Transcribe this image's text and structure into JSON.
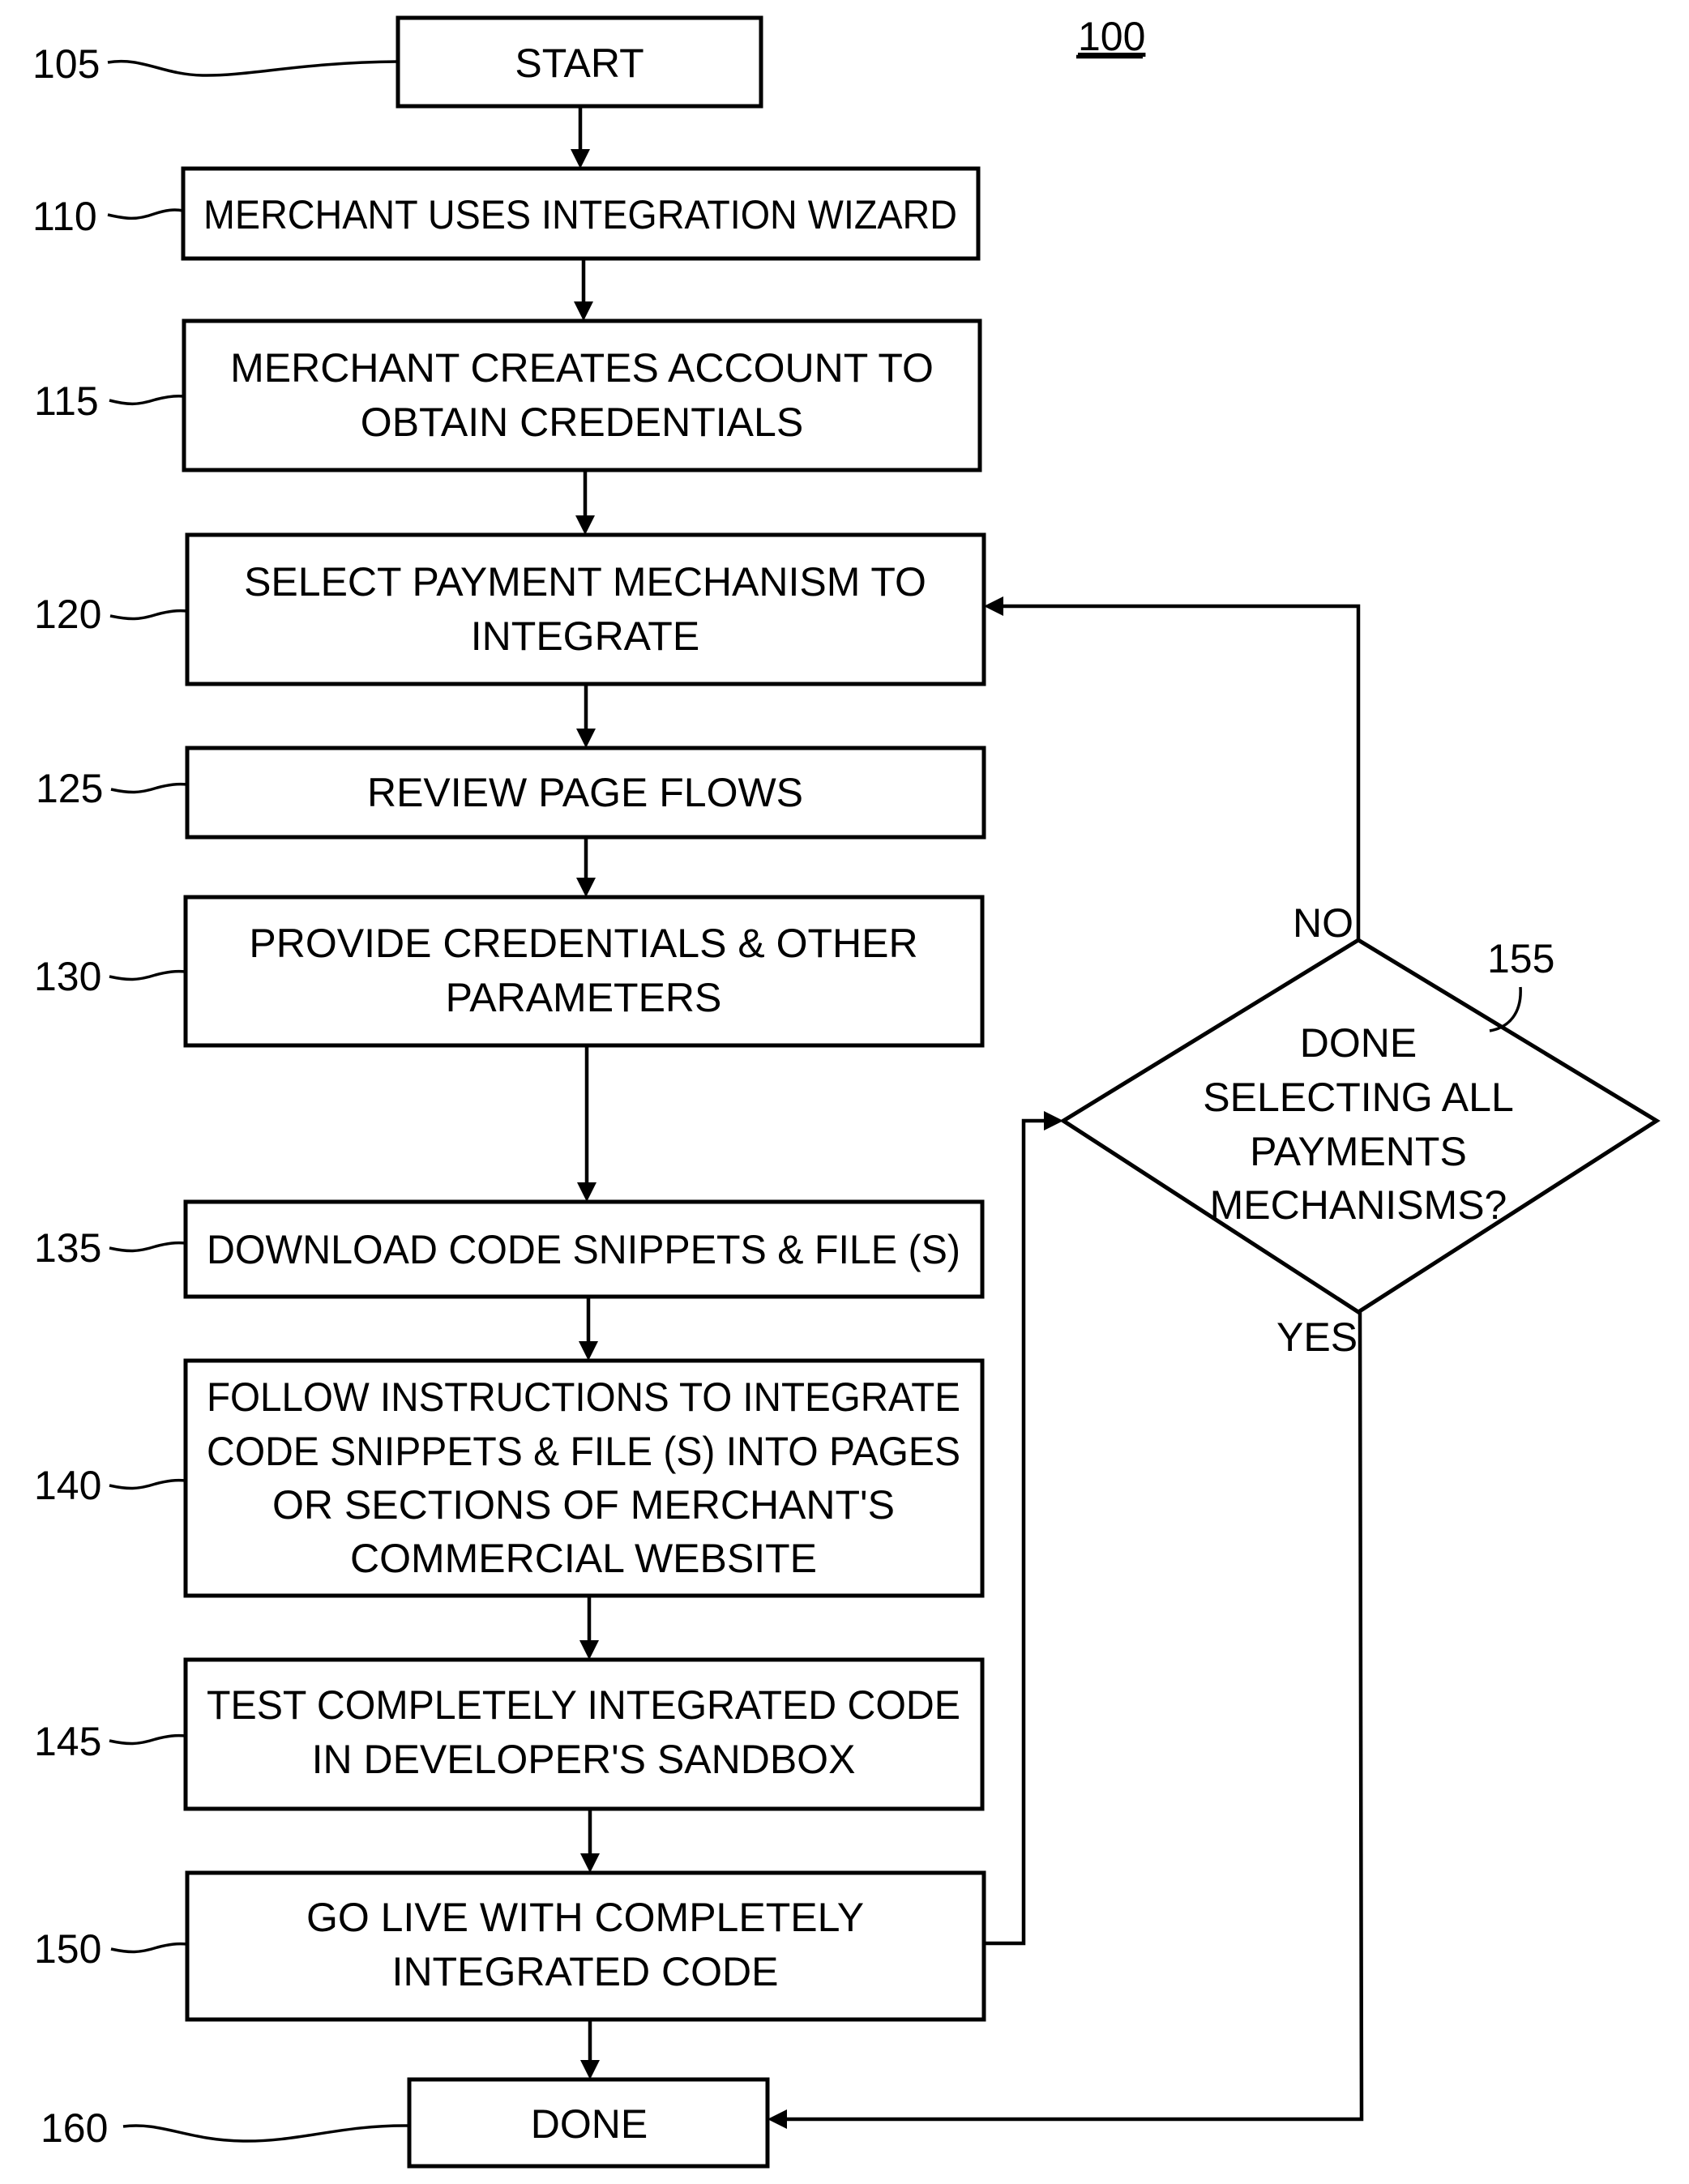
{
  "figure": {
    "number": "100"
  },
  "steps": [
    {
      "ref": "105",
      "lines": [
        "START"
      ]
    },
    {
      "ref": "110",
      "lines": [
        "MERCHANT USES INTEGRATION WIZARD"
      ]
    },
    {
      "ref": "115",
      "lines": [
        "MERCHANT CREATES ACCOUNT TO",
        "OBTAIN CREDENTIALS"
      ]
    },
    {
      "ref": "120",
      "lines": [
        "SELECT PAYMENT MECHANISM TO",
        "INTEGRATE"
      ]
    },
    {
      "ref": "125",
      "lines": [
        "REVIEW PAGE FLOWS"
      ]
    },
    {
      "ref": "130",
      "lines": [
        "PROVIDE CREDENTIALS & OTHER",
        "PARAMETERS"
      ]
    },
    {
      "ref": "135",
      "lines": [
        "DOWNLOAD CODE SNIPPETS & FILE (S)"
      ]
    },
    {
      "ref": "140",
      "lines": [
        "FOLLOW INSTRUCTIONS TO INTEGRATE",
        "CODE SNIPPETS & FILE (S) INTO PAGES",
        "OR SECTIONS OF MERCHANT'S",
        "COMMERCIAL WEBSITE"
      ]
    },
    {
      "ref": "145",
      "lines": [
        "TEST COMPLETELY INTEGRATED CODE",
        "IN DEVELOPER'S SANDBOX"
      ]
    },
    {
      "ref": "150",
      "lines": [
        "GO LIVE WITH COMPLETELY",
        "INTEGRATED CODE"
      ]
    },
    {
      "ref": "160",
      "lines": [
        "DONE"
      ]
    }
  ],
  "decision": {
    "ref": "155",
    "lines": [
      "DONE",
      "SELECTING ALL",
      "PAYMENTS",
      "MECHANISMS?"
    ],
    "no_label": "NO",
    "yes_label": "YES"
  }
}
